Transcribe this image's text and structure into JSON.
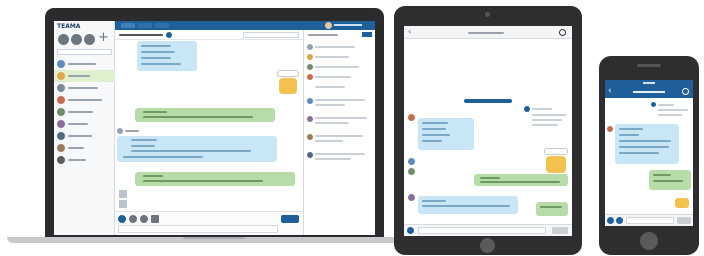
{
  "colors": {
    "laptop_frame": "#2b2b2d",
    "laptop_base": "#c7c9cc",
    "tablet_frame": "#2e2e30",
    "phone_frame": "#2e2e30",
    "sidebar_bg": "#ffffff",
    "header_blue": "#1f5f9a",
    "blue_bubble": "#c9e6f7",
    "green_bubble": "#b8dbaa",
    "accent_yellow": "#f2c14e",
    "highlight_green": "#dff0cf"
  },
  "laptop": {
    "logo_text": "TEAMA",
    "active_room_label": "",
    "send_button": ""
  },
  "tablet": {
    "title": ""
  },
  "phone": {
    "status_time": "",
    "title": ""
  }
}
